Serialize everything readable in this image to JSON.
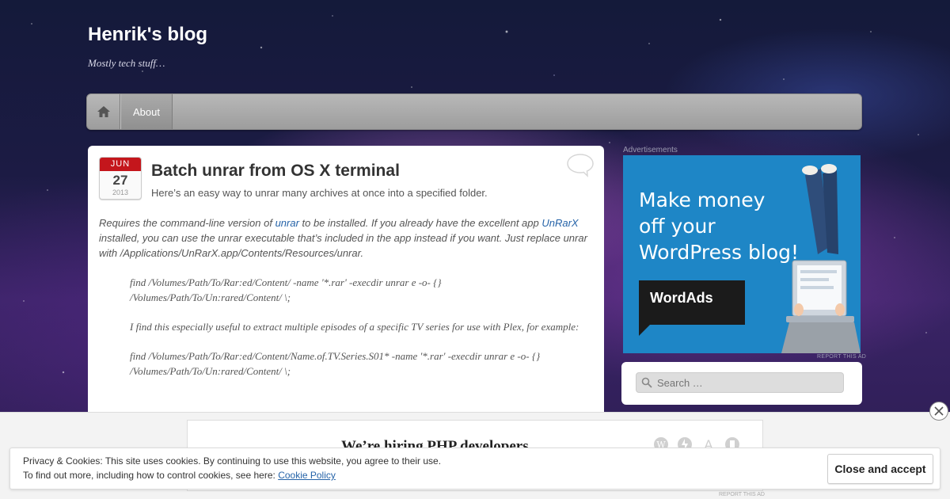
{
  "site": {
    "title": "Henrik's blog",
    "description": "Mostly tech stuff…"
  },
  "nav": {
    "home_icon": "home-icon",
    "items": [
      {
        "label": "About"
      }
    ]
  },
  "post": {
    "date": {
      "month": "JUN",
      "day": "27",
      "year": "2013"
    },
    "title": "Batch unrar from OS X terminal",
    "excerpt": "Here’s an easy way to unrar many archives at once into a specified folder.",
    "body": {
      "p1_a": "Requires the command-line version of ",
      "link_unrar": "unrar",
      "p1_b": " to be installed. If you already have the excellent app ",
      "link_unrarx": "UnRarX",
      "p1_c": " installed, you can use the unrar executable that’s included in the app instead if you want. Just replace unrar with /Applications/UnRarX.app/Contents/Resources/unrar."
    },
    "quote": {
      "line1": "find /Volumes/Path/To/Rar:ed/Content/ -name '*.rar' -execdir unrar e -o- {} /Volumes/Path/To/Un:rared/Content/ \\;",
      "line2": "I find this especially useful to extract multiple episodes of a specific TV series for use with Plex, for example:",
      "line3": "find /Volumes/Path/To/Rar:ed/Content/Name.of.TV.Series.S01* -name '*.rar' -execdir unrar e -o- {} /Volumes/Path/To/Un:rared/Content/ \\;"
    }
  },
  "sidebar": {
    "ad_label": "Advertisements",
    "ad": {
      "headline_1": "Make money",
      "headline_2": "off your",
      "headline_3": "WordPress blog!",
      "brand": "WordAds",
      "report": "REPORT THIS AD",
      "color": "#1e86c6"
    },
    "search": {
      "placeholder": "Search …"
    }
  },
  "bottom_ad": {
    "text": "We’re hiring PHP developers",
    "report": "REPORT THIS AD"
  },
  "cookie": {
    "line1": "Privacy & Cookies: This site uses cookies. By continuing to use this website, you agree to their use.",
    "line2_prefix": "To find out more, including how to control cookies, see here: ",
    "link": "Cookie Policy",
    "button": "Close and accept"
  },
  "colors": {
    "accent_link": "#2563a8",
    "date_red": "#c4161c"
  }
}
